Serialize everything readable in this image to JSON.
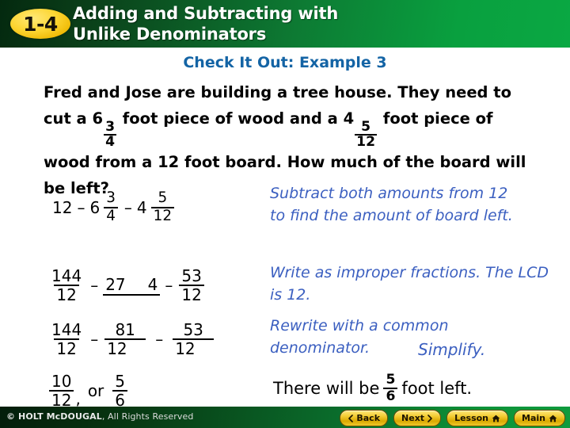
{
  "header": {
    "badge": "1-4",
    "title_line1": "Adding and Subtracting with",
    "title_line2": "Unlike Denominators",
    "bg_start": "#04290f",
    "bg_end": "#0aa843",
    "badge_color": "#fcd531"
  },
  "example_heading": "Check It Out: Example 3",
  "heading_color": "#1464a5",
  "problem": {
    "seg1": "Fred and Jose are building a tree house. They need to cut a 6",
    "frac1_num": "3",
    "frac1_den": "4",
    "seg2": " foot piece of wood and a 4",
    "frac2_num": "5",
    "frac2_den": "12",
    "seg3": " foot piece of wood from a 12 foot board. How much of the board will be left?"
  },
  "note_color": "#3b5fc0",
  "steps": [
    {
      "id": "step-1",
      "work": {
        "whole": "12",
        "op1": "–",
        "term2_whole": "6",
        "term2_num": "3",
        "term2_den": "4",
        "op2": "–",
        "term3_whole": "4",
        "term3_num": "5",
        "term3_den": "12"
      },
      "note": "Subtract both amounts from 12 to find the amount of board left."
    },
    {
      "id": "step-2",
      "work": {
        "f1_num": "144",
        "f1_den": "12",
        "op1": "–",
        "split_a": "27",
        "split_b": "4",
        "op2": "–",
        "f3_num": "53",
        "f3_den": "12"
      },
      "note": "Write as improper fractions. The LCD is 12."
    },
    {
      "id": "step-3",
      "work": {
        "f1_num": "144",
        "f1_den": "12",
        "op1": "–",
        "f2_num": "81",
        "f2_den": "12",
        "op2": "–",
        "f3_num": "53",
        "f3_den": "12"
      },
      "note": "Rewrite with a common denominator.",
      "note_extra": "Simplify."
    },
    {
      "id": "step-4",
      "work": {
        "f1_num": "10",
        "f1_den": "12",
        "comma": ",",
        "or": "or",
        "f2_num": "5",
        "f2_den": "6"
      }
    }
  ],
  "conclusion": {
    "before": "There will be",
    "frac_num": "5",
    "frac_den": "6",
    "after": "foot left."
  },
  "footer": {
    "copyright_bold": "© HOLT McDOUGAL",
    "copyright_rest": ", All Rights Reserved",
    "buttons": [
      {
        "label": "Back",
        "icon": "chevron-left-icon"
      },
      {
        "label": "Next",
        "icon": "chevron-right-icon"
      },
      {
        "label": "Lesson",
        "icon": "home-icon"
      },
      {
        "label": "Main",
        "icon": "home-icon"
      }
    ]
  }
}
